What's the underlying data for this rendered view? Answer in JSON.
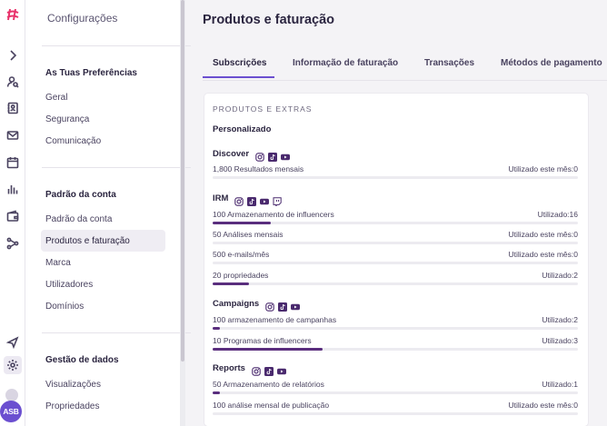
{
  "rail": {
    "avatar_initials": "ASB",
    "icons": [
      "logo-icon",
      "chevron-right-icon",
      "user-search-icon",
      "contacts-icon",
      "mail-icon",
      "calendar-icon",
      "bar-chart-icon",
      "wallet-icon",
      "workflow-icon",
      "send-icon",
      "gear-icon"
    ]
  },
  "sidebar": {
    "title": "Configurações",
    "sections": [
      {
        "title": "As Tuas Preferências",
        "items": [
          "Geral",
          "Segurança",
          "Comunicação"
        ]
      },
      {
        "title": "Padrão da conta",
        "items": [
          "Padrão da conta",
          "Produtos e faturação",
          "Marca",
          "Utilizadores",
          "Domínios"
        ]
      },
      {
        "title": "Gestão de dados",
        "items": [
          "Visualizações",
          "Propriedades"
        ]
      }
    ],
    "active_item": "Produtos e faturação"
  },
  "main": {
    "title": "Produtos e faturação",
    "tabs": [
      "Subscrições",
      "Informação de faturação",
      "Transações",
      "Métodos de pagamento"
    ],
    "active_tab": "Subscrições"
  },
  "card": {
    "caption": "PRODUTOS E EXTRAS",
    "group": "Personalizado",
    "products": [
      {
        "name": "Discover",
        "platforms": [
          "instagram",
          "tiktok",
          "youtube"
        ],
        "quotas": [
          {
            "label": "1,800 Resultados mensais",
            "usage": "Utilizado este mês:0",
            "fraction": 0
          }
        ]
      },
      {
        "name": "IRM",
        "platforms": [
          "instagram",
          "tiktok",
          "youtube",
          "twitch"
        ],
        "quotas": [
          {
            "label": "100 Armazenamento de influencers",
            "usage": "Utilizado:16",
            "fraction": 0.16
          },
          {
            "label": "50 Análises mensais",
            "usage": "Utilizado este mês:0",
            "fraction": 0
          },
          {
            "label": "500 e-mails/mês",
            "usage": "Utilizado este mês:0",
            "fraction": 0
          },
          {
            "label": "20 propriedades",
            "usage": "Utilizado:2",
            "fraction": 0.1
          }
        ]
      },
      {
        "name": "Campaigns",
        "platforms": [
          "instagram",
          "tiktok",
          "youtube"
        ],
        "quotas": [
          {
            "label": "100 armazenamento de campanhas",
            "usage": "Utilizado:2",
            "fraction": 0.02
          },
          {
            "label": "10 Programas de influencers",
            "usage": "Utilizado:3",
            "fraction": 0.3
          }
        ]
      },
      {
        "name": "Reports",
        "platforms": [
          "instagram",
          "tiktok",
          "youtube"
        ],
        "quotas": [
          {
            "label": "50 Armazenamento de relatórios",
            "usage": "Utilizado:1",
            "fraction": 0.02
          },
          {
            "label": "100 análise mensal de publicação",
            "usage": "Utilizado este mês:0",
            "fraction": 0
          }
        ]
      }
    ]
  },
  "colors": {
    "accent": "#6b4fd0",
    "bar": "#5a2e7e",
    "brand": "#e8336b"
  }
}
